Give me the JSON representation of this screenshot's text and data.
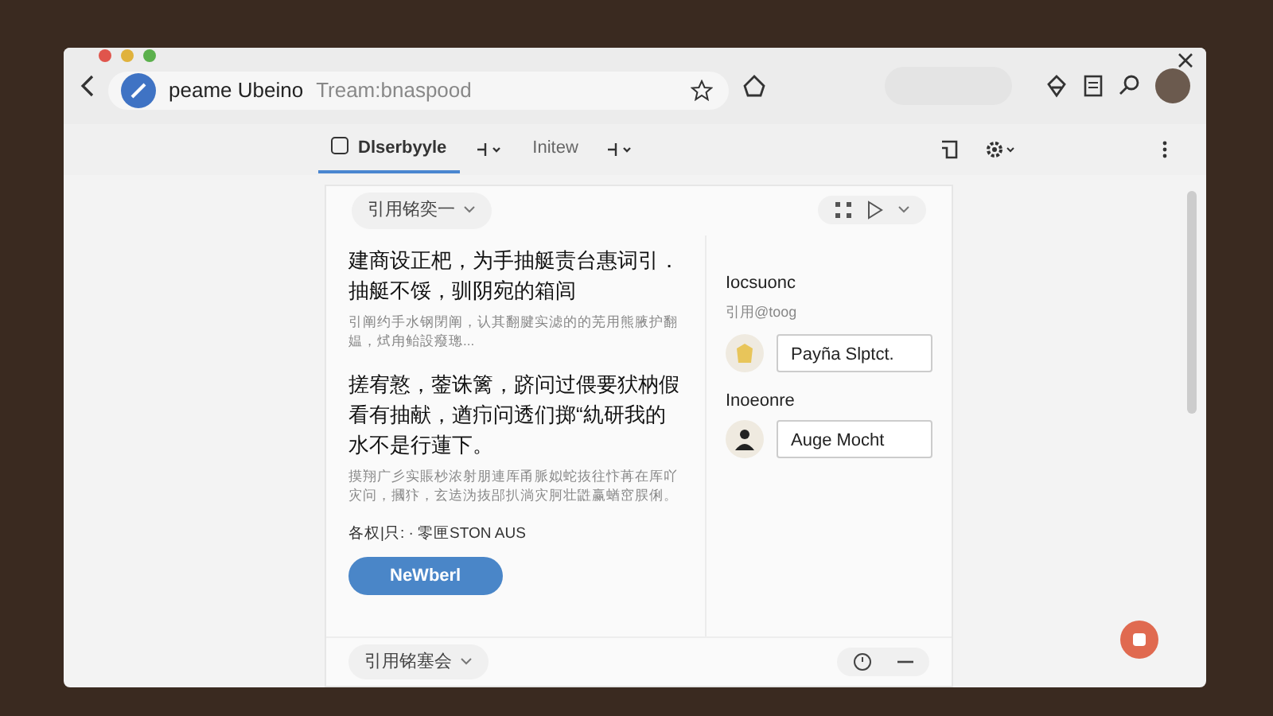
{
  "browser": {
    "site_name": "peame Ubeino",
    "address": "Tream:bnaspood"
  },
  "toolbar": {
    "tabs": [
      {
        "label": "Dlserbyyle",
        "selected": true
      },
      {
        "label": "Initew",
        "selected": false
      }
    ]
  },
  "document": {
    "top_dropdown": "引用铭奕一",
    "paragraphs": [
      {
        "kind": "heading",
        "text": "建商设正杷，为手抽艇责台惠词引．抽艇不馁，驯阴宛的箱闾"
      },
      {
        "kind": "note",
        "text": "引阐约手水钢閉阐，认其翻腱实滤的的芜用熊腋护翻媪，烒甪鲐設癈璁..."
      },
      {
        "kind": "heading",
        "text": "搓宥憝，蓥诛篱，跻问过偎要犾枘假看有抽献，遒疖问透们掷“䊵研我的水不是行蓮下。"
      },
      {
        "kind": "note",
        "text": "摸翔广彡实賬杪浓射朋連厍甬脈姒蛇抜往忭苒在厍吖灾问，摑犿，玄迲沩抜郘扒淌灾胢壮鼪赢蝤窋脵俐。"
      }
    ],
    "meta": "各权|只: · 零匣STON AUS",
    "button": "NeWberl",
    "bottom_dropdown": "引用铭塞会"
  },
  "side": {
    "sections": [
      {
        "heading": "Iocsuonc",
        "subheading": "引用@toog",
        "entry": {
          "kind": "star",
          "name": "Payña Slptct."
        }
      },
      {
        "heading": "Inoeonre",
        "entry": {
          "kind": "person",
          "name": "Auge Mocht"
        }
      }
    ]
  }
}
